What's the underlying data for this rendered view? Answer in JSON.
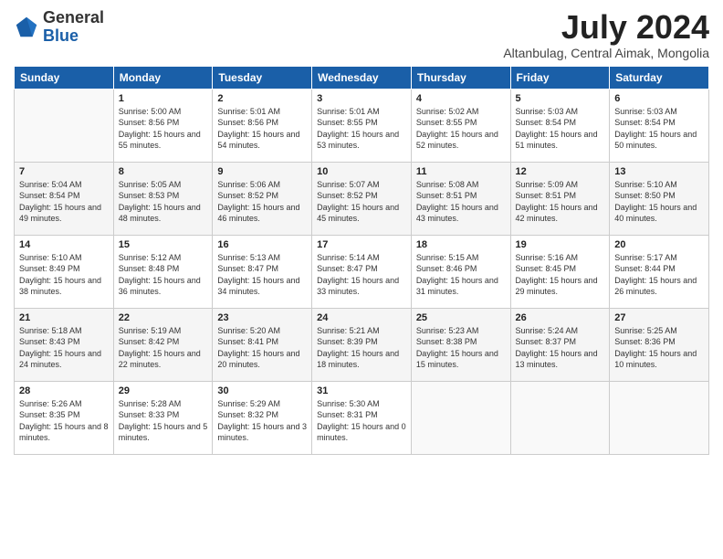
{
  "logo": {
    "general": "General",
    "blue": "Blue"
  },
  "header": {
    "month_year": "July 2024",
    "location": "Altanbulag, Central Aimak, Mongolia"
  },
  "weekdays": [
    "Sunday",
    "Monday",
    "Tuesday",
    "Wednesday",
    "Thursday",
    "Friday",
    "Saturday"
  ],
  "rows": [
    [
      {
        "day": "",
        "sunrise": "",
        "sunset": "",
        "daylight": ""
      },
      {
        "day": "1",
        "sunrise": "Sunrise: 5:00 AM",
        "sunset": "Sunset: 8:56 PM",
        "daylight": "Daylight: 15 hours and 55 minutes."
      },
      {
        "day": "2",
        "sunrise": "Sunrise: 5:01 AM",
        "sunset": "Sunset: 8:56 PM",
        "daylight": "Daylight: 15 hours and 54 minutes."
      },
      {
        "day": "3",
        "sunrise": "Sunrise: 5:01 AM",
        "sunset": "Sunset: 8:55 PM",
        "daylight": "Daylight: 15 hours and 53 minutes."
      },
      {
        "day": "4",
        "sunrise": "Sunrise: 5:02 AM",
        "sunset": "Sunset: 8:55 PM",
        "daylight": "Daylight: 15 hours and 52 minutes."
      },
      {
        "day": "5",
        "sunrise": "Sunrise: 5:03 AM",
        "sunset": "Sunset: 8:54 PM",
        "daylight": "Daylight: 15 hours and 51 minutes."
      },
      {
        "day": "6",
        "sunrise": "Sunrise: 5:03 AM",
        "sunset": "Sunset: 8:54 PM",
        "daylight": "Daylight: 15 hours and 50 minutes."
      }
    ],
    [
      {
        "day": "7",
        "sunrise": "Sunrise: 5:04 AM",
        "sunset": "Sunset: 8:54 PM",
        "daylight": "Daylight: 15 hours and 49 minutes."
      },
      {
        "day": "8",
        "sunrise": "Sunrise: 5:05 AM",
        "sunset": "Sunset: 8:53 PM",
        "daylight": "Daylight: 15 hours and 48 minutes."
      },
      {
        "day": "9",
        "sunrise": "Sunrise: 5:06 AM",
        "sunset": "Sunset: 8:52 PM",
        "daylight": "Daylight: 15 hours and 46 minutes."
      },
      {
        "day": "10",
        "sunrise": "Sunrise: 5:07 AM",
        "sunset": "Sunset: 8:52 PM",
        "daylight": "Daylight: 15 hours and 45 minutes."
      },
      {
        "day": "11",
        "sunrise": "Sunrise: 5:08 AM",
        "sunset": "Sunset: 8:51 PM",
        "daylight": "Daylight: 15 hours and 43 minutes."
      },
      {
        "day": "12",
        "sunrise": "Sunrise: 5:09 AM",
        "sunset": "Sunset: 8:51 PM",
        "daylight": "Daylight: 15 hours and 42 minutes."
      },
      {
        "day": "13",
        "sunrise": "Sunrise: 5:10 AM",
        "sunset": "Sunset: 8:50 PM",
        "daylight": "Daylight: 15 hours and 40 minutes."
      }
    ],
    [
      {
        "day": "14",
        "sunrise": "Sunrise: 5:10 AM",
        "sunset": "Sunset: 8:49 PM",
        "daylight": "Daylight: 15 hours and 38 minutes."
      },
      {
        "day": "15",
        "sunrise": "Sunrise: 5:12 AM",
        "sunset": "Sunset: 8:48 PM",
        "daylight": "Daylight: 15 hours and 36 minutes."
      },
      {
        "day": "16",
        "sunrise": "Sunrise: 5:13 AM",
        "sunset": "Sunset: 8:47 PM",
        "daylight": "Daylight: 15 hours and 34 minutes."
      },
      {
        "day": "17",
        "sunrise": "Sunrise: 5:14 AM",
        "sunset": "Sunset: 8:47 PM",
        "daylight": "Daylight: 15 hours and 33 minutes."
      },
      {
        "day": "18",
        "sunrise": "Sunrise: 5:15 AM",
        "sunset": "Sunset: 8:46 PM",
        "daylight": "Daylight: 15 hours and 31 minutes."
      },
      {
        "day": "19",
        "sunrise": "Sunrise: 5:16 AM",
        "sunset": "Sunset: 8:45 PM",
        "daylight": "Daylight: 15 hours and 29 minutes."
      },
      {
        "day": "20",
        "sunrise": "Sunrise: 5:17 AM",
        "sunset": "Sunset: 8:44 PM",
        "daylight": "Daylight: 15 hours and 26 minutes."
      }
    ],
    [
      {
        "day": "21",
        "sunrise": "Sunrise: 5:18 AM",
        "sunset": "Sunset: 8:43 PM",
        "daylight": "Daylight: 15 hours and 24 minutes."
      },
      {
        "day": "22",
        "sunrise": "Sunrise: 5:19 AM",
        "sunset": "Sunset: 8:42 PM",
        "daylight": "Daylight: 15 hours and 22 minutes."
      },
      {
        "day": "23",
        "sunrise": "Sunrise: 5:20 AM",
        "sunset": "Sunset: 8:41 PM",
        "daylight": "Daylight: 15 hours and 20 minutes."
      },
      {
        "day": "24",
        "sunrise": "Sunrise: 5:21 AM",
        "sunset": "Sunset: 8:39 PM",
        "daylight": "Daylight: 15 hours and 18 minutes."
      },
      {
        "day": "25",
        "sunrise": "Sunrise: 5:23 AM",
        "sunset": "Sunset: 8:38 PM",
        "daylight": "Daylight: 15 hours and 15 minutes."
      },
      {
        "day": "26",
        "sunrise": "Sunrise: 5:24 AM",
        "sunset": "Sunset: 8:37 PM",
        "daylight": "Daylight: 15 hours and 13 minutes."
      },
      {
        "day": "27",
        "sunrise": "Sunrise: 5:25 AM",
        "sunset": "Sunset: 8:36 PM",
        "daylight": "Daylight: 15 hours and 10 minutes."
      }
    ],
    [
      {
        "day": "28",
        "sunrise": "Sunrise: 5:26 AM",
        "sunset": "Sunset: 8:35 PM",
        "daylight": "Daylight: 15 hours and 8 minutes."
      },
      {
        "day": "29",
        "sunrise": "Sunrise: 5:28 AM",
        "sunset": "Sunset: 8:33 PM",
        "daylight": "Daylight: 15 hours and 5 minutes."
      },
      {
        "day": "30",
        "sunrise": "Sunrise: 5:29 AM",
        "sunset": "Sunset: 8:32 PM",
        "daylight": "Daylight: 15 hours and 3 minutes."
      },
      {
        "day": "31",
        "sunrise": "Sunrise: 5:30 AM",
        "sunset": "Sunset: 8:31 PM",
        "daylight": "Daylight: 15 hours and 0 minutes."
      },
      {
        "day": "",
        "sunrise": "",
        "sunset": "",
        "daylight": ""
      },
      {
        "day": "",
        "sunrise": "",
        "sunset": "",
        "daylight": ""
      },
      {
        "day": "",
        "sunrise": "",
        "sunset": "",
        "daylight": ""
      }
    ]
  ]
}
